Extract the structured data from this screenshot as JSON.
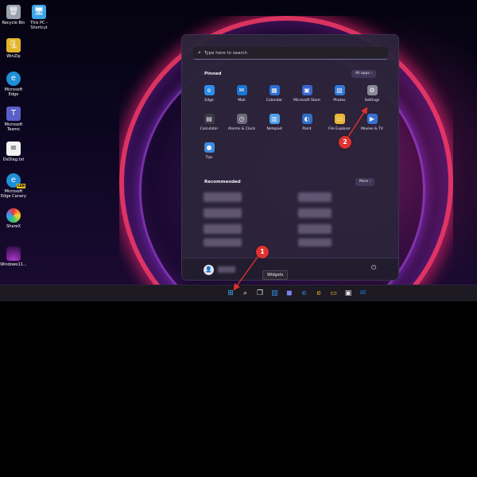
{
  "desktop": {
    "icons": [
      {
        "label": "Recycle Bin",
        "icon": "recycle-bin-icon"
      },
      {
        "label": "This PC - Shortcut",
        "icon": "computer-icon"
      },
      {
        "label": "WinZip",
        "icon": "winzip-icon"
      },
      {
        "label": "Microsoft Edge",
        "icon": "edge-icon"
      },
      {
        "label": "Microsoft Teams",
        "icon": "teams-icon"
      },
      {
        "label": "DxDiag.txt",
        "icon": "text-file-icon"
      },
      {
        "label": "Microsoft Edge Canary",
        "icon": "edge-canary-icon",
        "badge": "CAN"
      },
      {
        "label": "ShareX",
        "icon": "sharex-icon"
      },
      {
        "label": "Windows11...",
        "icon": "windows11-wallpaper-icon"
      }
    ]
  },
  "start_menu": {
    "search_placeholder": "Type here to search",
    "pinned_title": "Pinned",
    "all_apps_label": "All apps",
    "pinned_apps": [
      {
        "label": "Edge",
        "icon": "edge-icon",
        "color": "#2c8ee8"
      },
      {
        "label": "Mail",
        "icon": "mail-icon",
        "color": "#1b74d1"
      },
      {
        "label": "Calendar",
        "icon": "calendar-icon",
        "color": "#2b6fd0"
      },
      {
        "label": "Microsoft Store",
        "icon": "store-icon",
        "color": "#3a66cc"
      },
      {
        "label": "Photos",
        "icon": "photos-icon",
        "color": "#2f7ad8"
      },
      {
        "label": "Settings",
        "icon": "gear-icon",
        "color": "#8a8a96"
      },
      {
        "label": "Calculator",
        "icon": "calculator-icon",
        "color": "#3a3a44"
      },
      {
        "label": "Alarms & Clock",
        "icon": "clock-icon",
        "color": "#6b6b78"
      },
      {
        "label": "Notepad",
        "icon": "notepad-icon",
        "color": "#4ea0e6"
      },
      {
        "label": "Paint",
        "icon": "paint-icon",
        "color": "#2f6fc6"
      },
      {
        "label": "File Explorer",
        "icon": "folder-icon",
        "color": "#e9b835"
      },
      {
        "label": "Movies & TV",
        "icon": "movies-icon",
        "color": "#3571cf"
      },
      {
        "label": "Tips",
        "icon": "tips-icon",
        "color": "#3b8be0"
      }
    ],
    "recommended_title": "Recommended",
    "more_label": "More",
    "tooltip": "Widgets"
  },
  "taskbar": {
    "icons": [
      {
        "icon": "windows-start-icon",
        "color": "#4aa8f0"
      },
      {
        "icon": "search-icon",
        "color": "#e8e8e8"
      },
      {
        "icon": "task-view-icon",
        "color": "#e8e8e8"
      },
      {
        "icon": "widgets-icon",
        "color": "#3d8ee6"
      },
      {
        "icon": "teams-chat-icon",
        "color": "#7b83eb"
      },
      {
        "icon": "edge-icon",
        "color": "#2c8ee8"
      },
      {
        "icon": "edge-canary-icon",
        "color": "#e0b030"
      },
      {
        "icon": "file-explorer-icon",
        "color": "#e9b835"
      },
      {
        "icon": "store-icon",
        "color": "#e8e8e8"
      },
      {
        "icon": "mail-icon",
        "color": "#1b74d1"
      }
    ]
  },
  "callouts": [
    {
      "number": "1"
    },
    {
      "number": "2"
    }
  ]
}
